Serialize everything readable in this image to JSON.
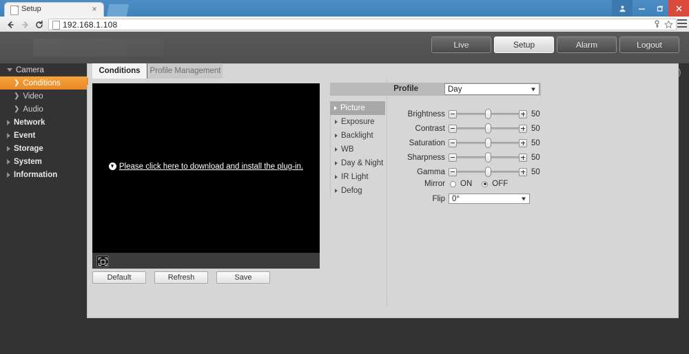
{
  "browser": {
    "tab_title": "Setup",
    "tab_close": "×",
    "url": "192.168.1.108",
    "icons": {
      "back": "back-arrow-icon",
      "forward": "forward-arrow-icon",
      "reload": "reload-icon",
      "key": "password-key-icon",
      "star": "bookmark-star-icon",
      "menu": "hamburger-menu-icon",
      "user": "user-profile-icon",
      "minimize": "minimize-icon",
      "maximize": "maximize-icon",
      "close": "close-icon"
    }
  },
  "topnav": {
    "items": [
      {
        "label": "Live",
        "active": false
      },
      {
        "label": "Setup",
        "active": true
      },
      {
        "label": "Alarm",
        "active": false
      },
      {
        "label": "Logout",
        "active": false
      }
    ],
    "help_icon": "?"
  },
  "sidebar": {
    "items": [
      {
        "label": "Camera",
        "type": "group-open",
        "selected": false
      },
      {
        "label": "Conditions",
        "type": "child",
        "selected": true
      },
      {
        "label": "Video",
        "type": "child",
        "selected": false
      },
      {
        "label": "Audio",
        "type": "child",
        "selected": false
      },
      {
        "label": "Network",
        "type": "group",
        "selected": false
      },
      {
        "label": "Event",
        "type": "group",
        "selected": false
      },
      {
        "label": "Storage",
        "type": "group",
        "selected": false
      },
      {
        "label": "System",
        "type": "group",
        "selected": false
      },
      {
        "label": "Information",
        "type": "group",
        "selected": false
      }
    ]
  },
  "panel_tabs": [
    {
      "label": "Conditions",
      "active": true
    },
    {
      "label": "Profile Management",
      "active": false
    }
  ],
  "video": {
    "plugin_message": "Please click here to download and install the plug-in.",
    "fullscreen_icon": "fullscreen-icon"
  },
  "actions": [
    {
      "label": "Default"
    },
    {
      "label": "Refresh"
    },
    {
      "label": "Save"
    }
  ],
  "settings": {
    "profile_label": "Profile",
    "profile_value": "Day",
    "submenu": [
      {
        "label": "Picture",
        "active": true
      },
      {
        "label": "Exposure",
        "active": false
      },
      {
        "label": "Backlight",
        "active": false
      },
      {
        "label": "WB",
        "active": false
      },
      {
        "label": "Day & Night",
        "active": false
      },
      {
        "label": "IR Light",
        "active": false
      },
      {
        "label": "Defog",
        "active": false
      }
    ],
    "sliders": [
      {
        "label": "Brightness",
        "value": "50"
      },
      {
        "label": "Contrast",
        "value": "50"
      },
      {
        "label": "Saturation",
        "value": "50"
      },
      {
        "label": "Sharpness",
        "value": "50"
      },
      {
        "label": "Gamma",
        "value": "50"
      }
    ],
    "mirror": {
      "label": "Mirror",
      "on_label": "ON",
      "off_label": "OFF",
      "selected": "OFF"
    },
    "flip": {
      "label": "Flip",
      "value": "0°"
    }
  },
  "colors": {
    "accent_orange": "#e8892a",
    "sidebar_bg": "#333333",
    "panel_bg": "#d6d6d6",
    "header_bg": "#545454",
    "browser_blue": "#4c8ec4",
    "close_red": "#d94a3d"
  }
}
